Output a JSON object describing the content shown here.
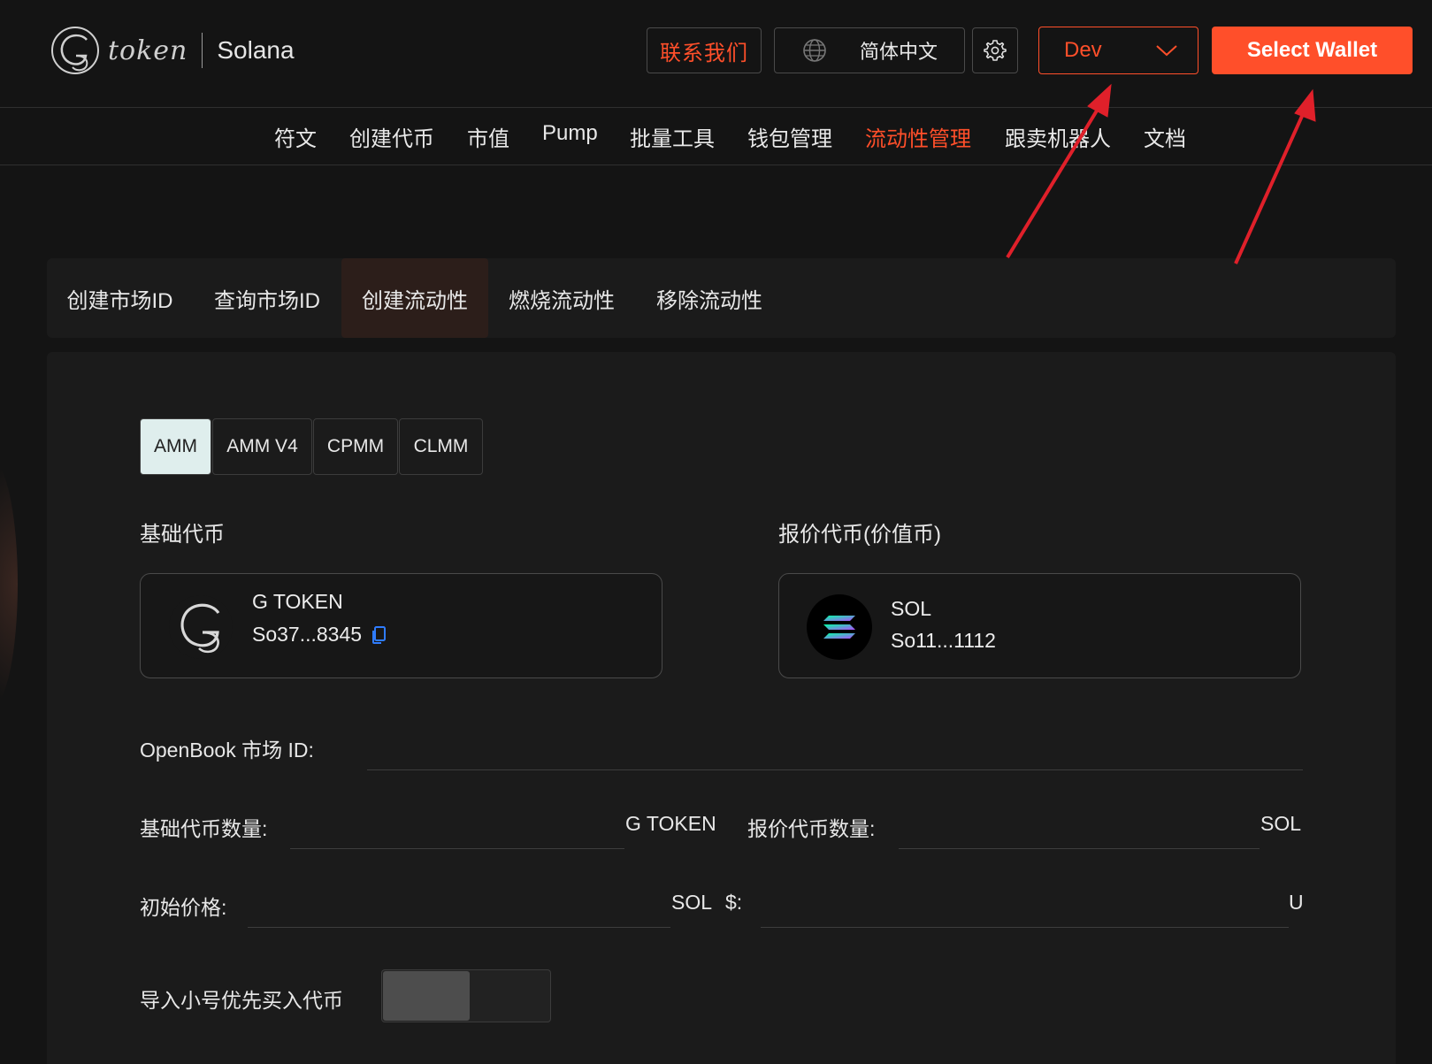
{
  "header": {
    "logo_text": "token",
    "chain": "Solana",
    "contact_label": "联系我们",
    "language_label": "简体中文",
    "network_label": "Dev",
    "wallet_label": "Select Wallet"
  },
  "nav": {
    "items": [
      {
        "label": "符文"
      },
      {
        "label": "创建代币"
      },
      {
        "label": "市值"
      },
      {
        "label": "Pump"
      },
      {
        "label": "批量工具"
      },
      {
        "label": "钱包管理"
      },
      {
        "label": "流动性管理",
        "active": true
      },
      {
        "label": "跟卖机器人"
      },
      {
        "label": "文档"
      }
    ]
  },
  "subtabs": {
    "items": [
      {
        "label": "创建市场ID"
      },
      {
        "label": "查询市场ID"
      },
      {
        "label": "创建流动性",
        "active": true
      },
      {
        "label": "燃烧流动性"
      },
      {
        "label": "移除流动性"
      }
    ]
  },
  "pool_types": {
    "items": [
      {
        "label": "AMM",
        "active": true
      },
      {
        "label": "AMM V4"
      },
      {
        "label": "CPMM"
      },
      {
        "label": "CLMM"
      }
    ]
  },
  "base_token": {
    "section_label": "基础代币",
    "name": "G TOKEN",
    "address": "So37...8345"
  },
  "quote_token": {
    "section_label": "报价代币(价值币)",
    "name": "SOL",
    "address": "So11...1112"
  },
  "form": {
    "market_id_label": "OpenBook 市场 ID:",
    "market_id_value": "",
    "base_amount_label": "基础代币数量:",
    "base_amount_unit": "G TOKEN",
    "base_amount_value": "",
    "quote_amount_label": "报价代币数量:",
    "quote_amount_unit": "SOL",
    "quote_amount_value": "",
    "init_price_label": "初始价格:",
    "init_price_unit": "SOL",
    "usd_label": "$:",
    "usd_unit": "U",
    "init_price_value": "",
    "usd_value": "",
    "priority_buy_label": "导入小号优先买入代币",
    "priority_buy_enabled": false
  },
  "colors": {
    "accent": "#ff4f2a",
    "background": "#141414",
    "card": "#1b1b1b",
    "active_pool_type": "#dfeeed",
    "annotation_arrow": "#e0202a"
  }
}
